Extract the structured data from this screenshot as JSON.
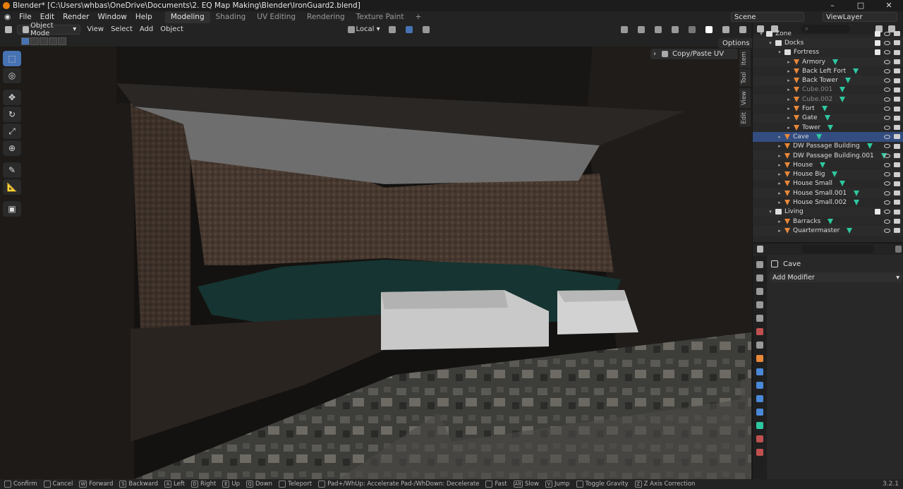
{
  "window": {
    "title": "Blender* [C:\\Users\\whbas\\OneDrive\\Documents\\2. EQ Map Making\\Blender\\IronGuard2.blend]"
  },
  "menu": {
    "items": [
      "File",
      "Edit",
      "Render",
      "Window",
      "Help"
    ]
  },
  "workspaces": [
    "Modeling",
    "Shading",
    "UV Editing",
    "Rendering",
    "Texture Paint",
    "+"
  ],
  "scene": {
    "name": "Scene",
    "view_layer": "ViewLayer"
  },
  "viewport_header": {
    "mode": "Object Mode",
    "menus": [
      "View",
      "Select",
      "Add",
      "Object"
    ],
    "orientation": "Local"
  },
  "viewport": {
    "options_label": "Options",
    "npanel_item": "Copy/Paste UV",
    "side_tabs": [
      "Item",
      "Tool",
      "View",
      "Edit"
    ]
  },
  "outliner": {
    "rows": [
      {
        "label": "Zone",
        "type": "collection",
        "indent": 0
      },
      {
        "label": "Docks",
        "type": "collection",
        "indent": 1
      },
      {
        "label": "Fortress",
        "type": "collection",
        "indent": 2
      },
      {
        "label": "Armory",
        "type": "mesh",
        "indent": 3
      },
      {
        "label": "Back Left Fort",
        "type": "mesh",
        "indent": 3
      },
      {
        "label": "Back Tower",
        "type": "mesh",
        "indent": 3
      },
      {
        "label": "Cube.001",
        "type": "mesh",
        "indent": 3,
        "dim": true
      },
      {
        "label": "Cube.002",
        "type": "mesh",
        "indent": 3,
        "dim": true
      },
      {
        "label": "Fort",
        "type": "mesh",
        "indent": 3
      },
      {
        "label": "Gate",
        "type": "mesh",
        "indent": 3
      },
      {
        "label": "Tower",
        "type": "mesh",
        "indent": 3
      },
      {
        "label": "Cave",
        "type": "mesh",
        "indent": 2,
        "selected": true
      },
      {
        "label": "DW Passage Building",
        "type": "mesh",
        "indent": 2
      },
      {
        "label": "DW Passage Building.001",
        "type": "mesh",
        "indent": 2
      },
      {
        "label": "House",
        "type": "mesh",
        "indent": 2
      },
      {
        "label": "House Big",
        "type": "mesh",
        "indent": 2
      },
      {
        "label": "House Small",
        "type": "mesh",
        "indent": 2
      },
      {
        "label": "House Small.001",
        "type": "mesh",
        "indent": 2
      },
      {
        "label": "House Small.002",
        "type": "mesh",
        "indent": 2
      },
      {
        "label": "Living",
        "type": "collection",
        "indent": 1
      },
      {
        "label": "Barracks",
        "type": "mesh",
        "indent": 2
      },
      {
        "label": "Quartermaster",
        "type": "mesh",
        "indent": 2
      }
    ]
  },
  "properties": {
    "object_name": "Cave",
    "add_modifier": "Add Modifier"
  },
  "statusbar": {
    "items": [
      {
        "key": "",
        "label": "Confirm"
      },
      {
        "key": "",
        "label": "Cancel"
      },
      {
        "key": "W",
        "label": "Forward"
      },
      {
        "key": "S",
        "label": "Backward"
      },
      {
        "key": "A",
        "label": "Left"
      },
      {
        "key": "D",
        "label": "Right"
      },
      {
        "key": "E",
        "label": "Up"
      },
      {
        "key": "Q",
        "label": "Down"
      },
      {
        "key": "",
        "label": "Teleport"
      },
      {
        "key": "",
        "label": "Pad+/WhUp: Accelerate Pad-/WhDown: Decelerate"
      },
      {
        "key": "",
        "label": "Fast"
      },
      {
        "key": "Alt",
        "label": "Slow"
      },
      {
        "key": "V",
        "label": "Jump"
      },
      {
        "key": "",
        "label": "Toggle Gravity"
      },
      {
        "key": "Z",
        "label": "Z Axis Correction"
      }
    ],
    "version": "3.2.1"
  }
}
